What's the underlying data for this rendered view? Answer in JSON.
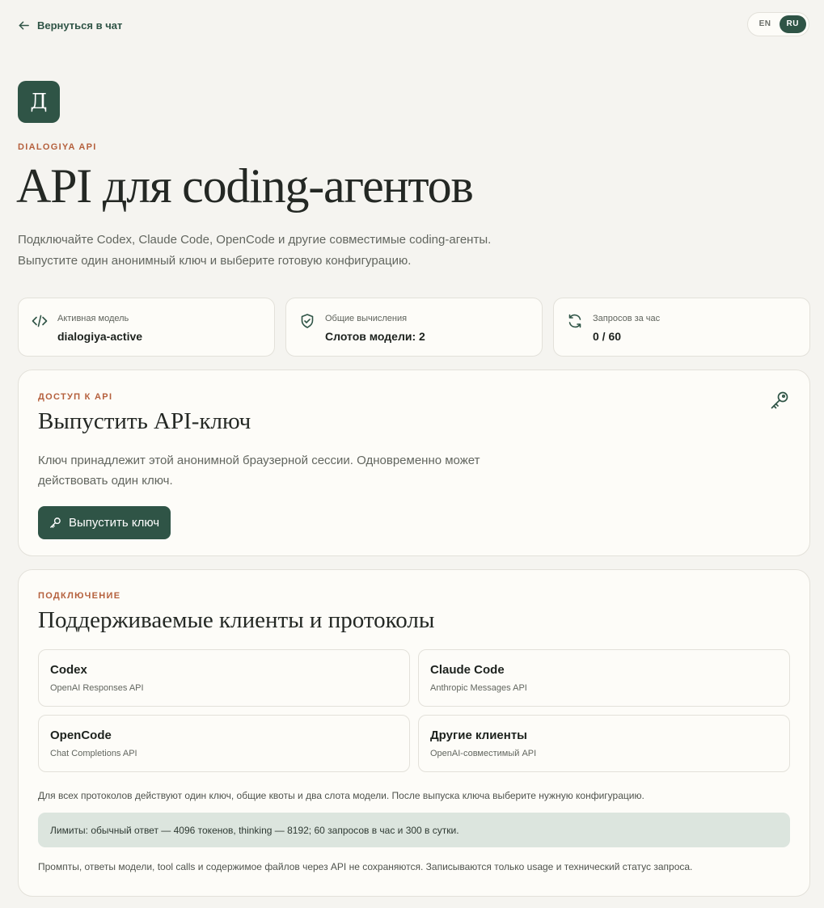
{
  "nav": {
    "back_label": "Вернуться в чат",
    "languages": [
      {
        "code": "EN",
        "active": false
      },
      {
        "code": "RU",
        "active": true
      }
    ]
  },
  "hero": {
    "logo_letter": "Д",
    "eyebrow": "DIALOGIYA API",
    "title": "API для coding-агентов",
    "desc_line1": "Подключайте Codex, Claude Code, OpenCode и другие совместимые coding-агенты.",
    "desc_line2": "Выпустите один анонимный ключ и выберите готовую конфигурацию."
  },
  "stats": [
    {
      "icon": "code-icon",
      "label": "Активная модель",
      "value": "dialogiya-active"
    },
    {
      "icon": "shield-check-icon",
      "label": "Общие вычисления",
      "value": "Слотов модели: 2"
    },
    {
      "icon": "refresh-icon",
      "label": "Запросов за час",
      "value": "0 / 60"
    }
  ],
  "access": {
    "eyebrow": "ДОСТУП К API",
    "title": "Выпустить API-ключ",
    "desc_line1": "Ключ принадлежит этой анонимной браузерной сессии. Одновременно может",
    "desc_line2": "действовать один ключ.",
    "button_label": "Выпустить ключ"
  },
  "connection": {
    "eyebrow": "ПОДКЛЮЧЕНИЕ",
    "title": "Поддерживаемые клиенты и протоколы",
    "clients": [
      {
        "name": "Codex",
        "protocol": "OpenAI Responses API"
      },
      {
        "name": "Claude Code",
        "protocol": "Anthropic Messages API"
      },
      {
        "name": "OpenCode",
        "protocol": "Chat Completions API"
      },
      {
        "name": "Другие клиенты",
        "protocol": "OpenAI-совместимый API"
      }
    ],
    "note": "Для всех протоколов действуют один ключ, общие квоты и два слота модели. После выпуска ключа выберите нужную конфигурацию.",
    "limits": "Лимиты: обычный ответ — 4096 токенов, thinking — 8192; 60 запросов в час и 300 в сутки.",
    "privacy": "Промпты, ответы модели, tool calls и содержимое файлов через API не сохраняются. Записываются только usage и технический статус запроса."
  },
  "colors": {
    "accent": "#2f5446",
    "eyebrow": "#b5603d",
    "background": "#f5f4f0",
    "card": "#fdfcf8",
    "limits_bg": "#dce5de"
  }
}
